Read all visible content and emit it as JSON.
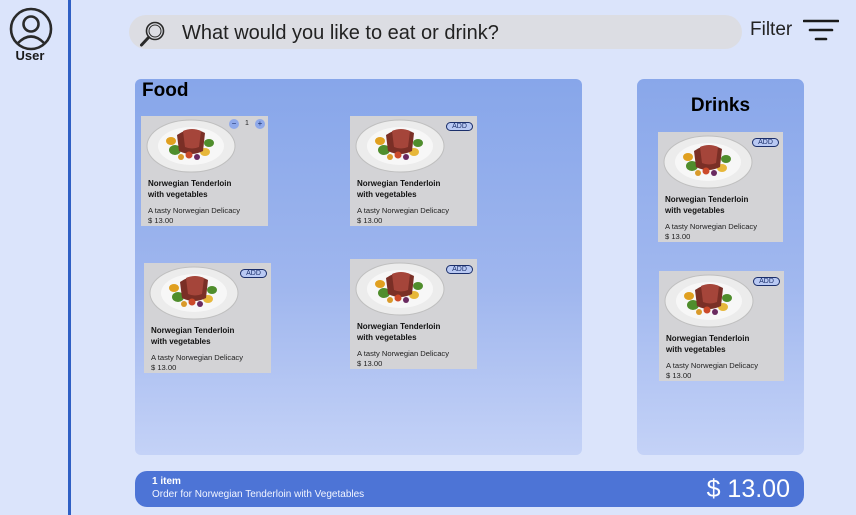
{
  "sidebar": {
    "user_label": "User",
    "icon": "user-circle-icon"
  },
  "search": {
    "placeholder": "What would you like to eat or drink?",
    "icon": "search-icon"
  },
  "filter": {
    "label": "Filter",
    "icon": "filter-lines-icon"
  },
  "food": {
    "title": "Food",
    "items": [
      {
        "name_line1": "Norwegian Tenderloin",
        "name_line2": "with vegetables",
        "description": "A tasty Norwegian Delicacy",
        "price": "$ 13.00",
        "quantity": "1",
        "minus_label": "−",
        "plus_label": "+"
      },
      {
        "name_line1": "Norwegian Tenderloin",
        "name_line2": "with vegetables",
        "description": "A tasty Norwegian Delicacy",
        "price": "$ 13.00",
        "add_label": "ADD"
      },
      {
        "name_line1": "Norwegian Tenderloin",
        "name_line2": "with vegetables",
        "description": "A tasty Norwegian Delicacy",
        "price": "$ 13.00",
        "add_label": "ADD"
      },
      {
        "name_line1": "Norwegian Tenderloin",
        "name_line2": "with vegetables",
        "description": "A tasty Norwegian Delicacy",
        "price": "$ 13.00",
        "add_label": "ADD"
      }
    ]
  },
  "drinks": {
    "title": "Drinks",
    "items": [
      {
        "name_line1": "Norwegian Tenderloin",
        "name_line2": "with vegetables",
        "description": "A tasty Norwegian Delicacy",
        "price": "$ 13.00",
        "add_label": "ADD"
      },
      {
        "name_line1": "Norwegian Tenderloin",
        "name_line2": "with vegetables",
        "description": "A tasty Norwegian Delicacy",
        "price": "$ 13.00",
        "add_label": "ADD"
      }
    ]
  },
  "order": {
    "count": "1 item",
    "description": "Order for Norwegian Tenderloin with Vegetables",
    "total": "$ 13.00"
  },
  "colors": {
    "accent": "#4d74d6",
    "sidebar_line": "#2f5fc4",
    "background": "#dbe4fb",
    "card": "#d3d3d6"
  }
}
